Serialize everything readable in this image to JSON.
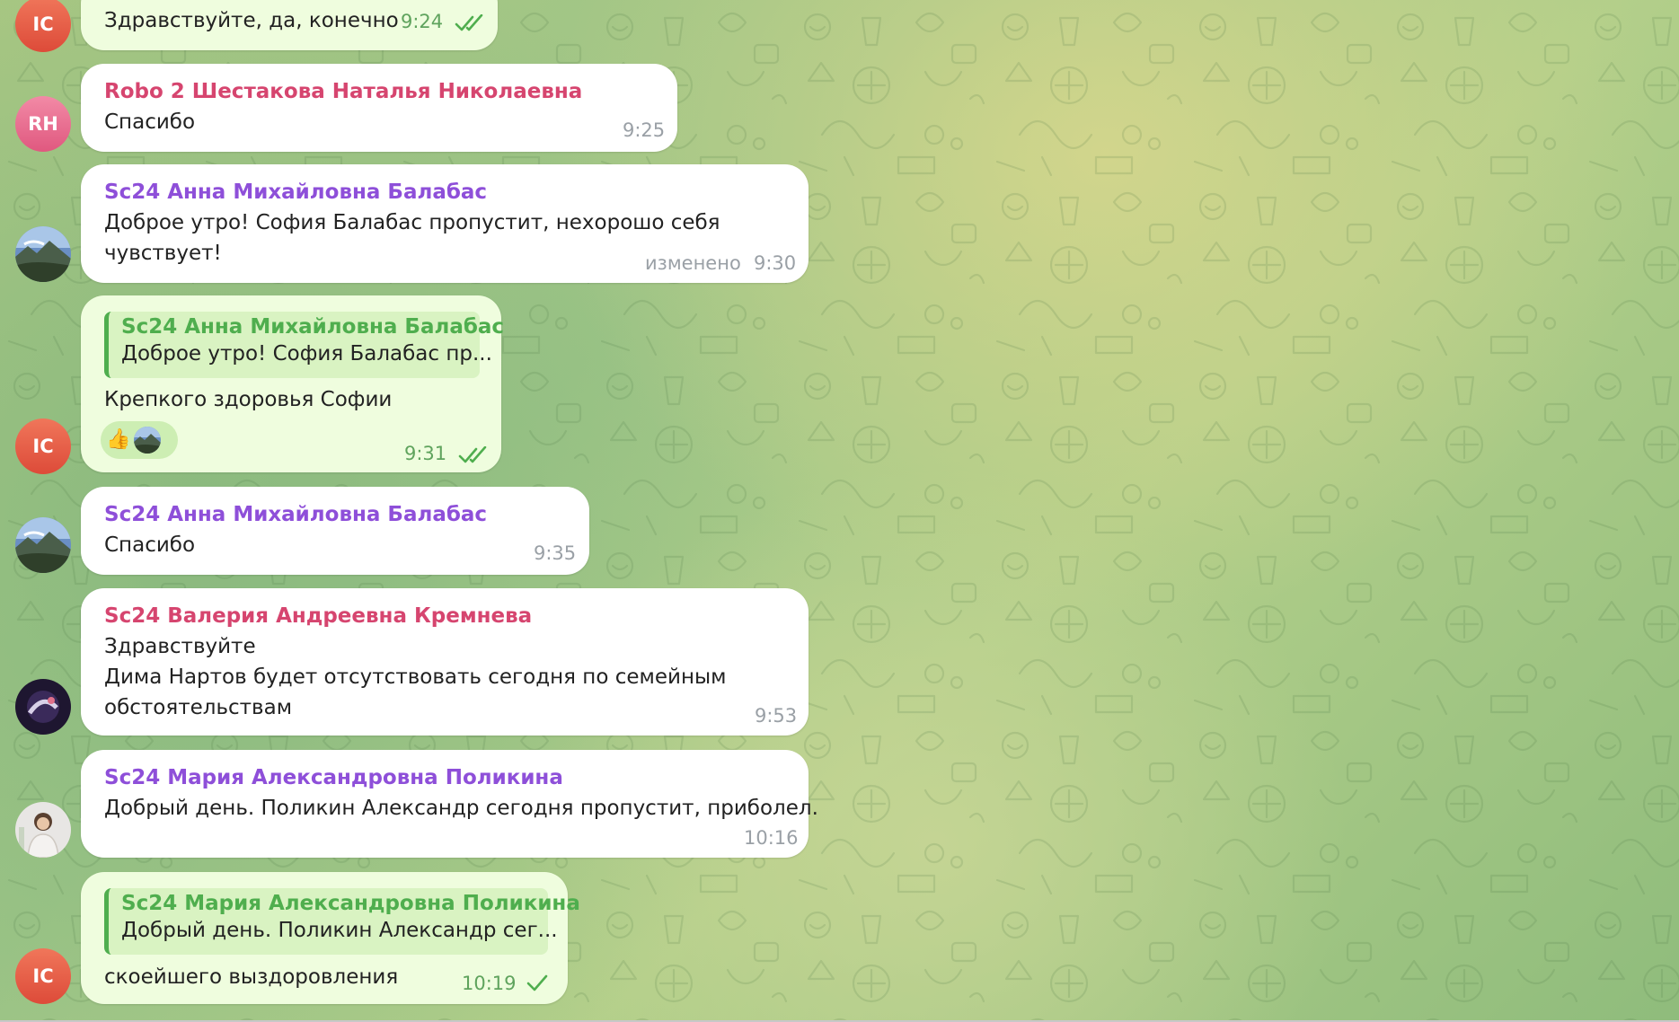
{
  "colors": {
    "incoming_bubble": "#ffffff",
    "outgoing_bubble": "#effdde",
    "sender_pink": "#d6456f",
    "sender_purple": "#8e4fd9",
    "quote_accent": "#4fae4e",
    "read_ticks": "#4fae4e"
  },
  "messages": [
    {
      "direction": "outgoing",
      "avatar": "IC",
      "text": "Здравствуйте, да, конечно",
      "time": "9:24",
      "status": "read"
    },
    {
      "direction": "incoming",
      "avatar": "RH",
      "sender": "Robo 2 Шестакова Наталья Николаевна",
      "text": "Спасибо",
      "time": "9:25"
    },
    {
      "direction": "incoming",
      "avatar_icon": "mountain-landscape-avatar",
      "sender": "Sc24 Анна Михайловна Балабас",
      "lines": [
        "Доброе утро! София Балабас пропустит, нехорошо себя",
        "чувствует!"
      ],
      "edited": "изменено",
      "time": "9:30"
    },
    {
      "direction": "outgoing",
      "avatar": "IC",
      "quote": {
        "sender": "Sc24 Анна Михайловна Балабас",
        "text": "Доброе утро! София Балабас пр..."
      },
      "text": "Крепкого здоровья Софии",
      "reaction_emoji": "👍",
      "reaction_icon": "thumbs-up-icon",
      "time": "9:31",
      "status": "read"
    },
    {
      "direction": "incoming",
      "avatar_icon": "mountain-landscape-avatar",
      "sender": "Sc24 Анна Михайловна Балабас",
      "text": "Спасибо",
      "time": "9:35"
    },
    {
      "direction": "incoming",
      "avatar_icon": "dark-space-avatar",
      "sender": "Sc24 Валерия Андреевна Кремнева",
      "lines": [
        "Здравствуйте",
        "Дима Нартов будет отсутствовать сегодня по семейным",
        "обстоятельствам"
      ],
      "time": "9:53"
    },
    {
      "direction": "incoming",
      "avatar_icon": "woman-photo-avatar",
      "sender": "Sc24 Мария Александровна Поликина",
      "text": "Добрый день. Поликин Александр сегодня пропустит, приболел.",
      "time": "10:16"
    },
    {
      "direction": "outgoing",
      "avatar": "IC",
      "quote": {
        "sender": "Sc24 Мария Александровна Поликина",
        "text": "Добрый день. Поликин Александр сег..."
      },
      "text": "скоейшего выздоровления",
      "time": "10:19",
      "status": "sent"
    }
  ]
}
